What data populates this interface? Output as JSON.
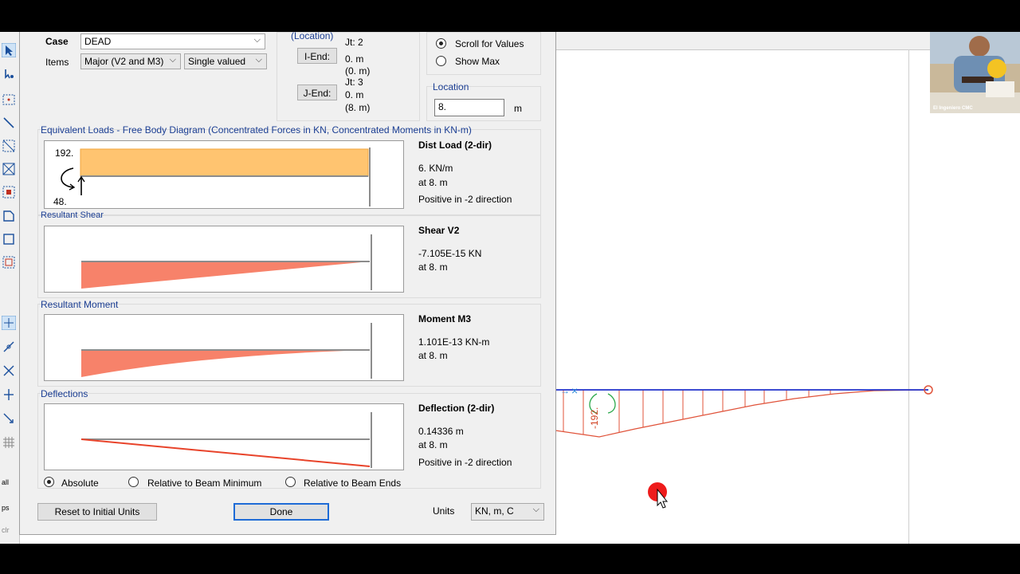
{
  "dialog": {
    "case_label": "Case",
    "case_value": "DEAD",
    "items_label": "Items",
    "items_value": "Major (V2 and M3)",
    "items_mode": "Single valued",
    "location_header": "(Location)",
    "iend_button": "I-End:",
    "iend_joint": "Jt:  2",
    "iend_local": "0. m",
    "iend_global": "(0. m)",
    "jend_button": "J-End:",
    "jend_joint": "Jt:  3",
    "jend_local": "0. m",
    "jend_global": "(8. m)",
    "scroll_for_values": "Scroll for Values",
    "show_max": "Show Max",
    "location_label": "Location",
    "location_value": "8.",
    "location_unit": "m",
    "equivalent_loads_title": "Equivalent Loads - Free Body Diagram  (Concentrated Forces in KN, Concentrated Moments in KN-m)",
    "fbd_moment": "192.",
    "fbd_force": "48.",
    "dist_load": {
      "title": "Dist Load (2-dir)",
      "value": "6. KN/m",
      "at": "at 8. m",
      "note": "Positive in -2 direction"
    },
    "resultant_shear_title": "Resultant Shear",
    "shear": {
      "title": "Shear V2",
      "value": "-7.105E-15 KN",
      "at": "at 8. m"
    },
    "resultant_moment_title": "Resultant Moment",
    "moment": {
      "title": "Moment M3",
      "value": "1.101E-13 KN-m",
      "at": "at 8. m"
    },
    "deflections_title": "Deflections",
    "deflection": {
      "title": "Deflection (2-dir)",
      "value": "0.14336 m",
      "at": "at 8. m",
      "note": "Positive in -2 direction"
    },
    "deflection_modes": {
      "absolute": "Absolute",
      "rel_min": "Relative to Beam Minimum",
      "rel_ends": "Relative to Beam Ends"
    },
    "reset_button": "Reset to Initial Units",
    "done_button": "Done",
    "units_label": "Units",
    "units_value": "KN, m, C"
  },
  "background": {
    "moment_label": "-192.",
    "webcam_caption": "El Ingeniero CMC"
  },
  "toolbar": {
    "icons": [
      "pointer-icon",
      "reshape-icon",
      "select-box-icon",
      "draw-line-icon",
      "select-intersect-icon",
      "cross-icon",
      "grid-icon",
      "area-icon",
      "rectangle-icon",
      "dotted-rect-icon"
    ],
    "labels": [
      "all",
      "ps",
      "clr"
    ]
  },
  "colors": {
    "load_fill": "#ffc470",
    "diagram_fill": "#f7826a",
    "diagram_line": "#e8432a",
    "beam_line": "#2233cc",
    "accent_blue": "#1c3f94"
  }
}
